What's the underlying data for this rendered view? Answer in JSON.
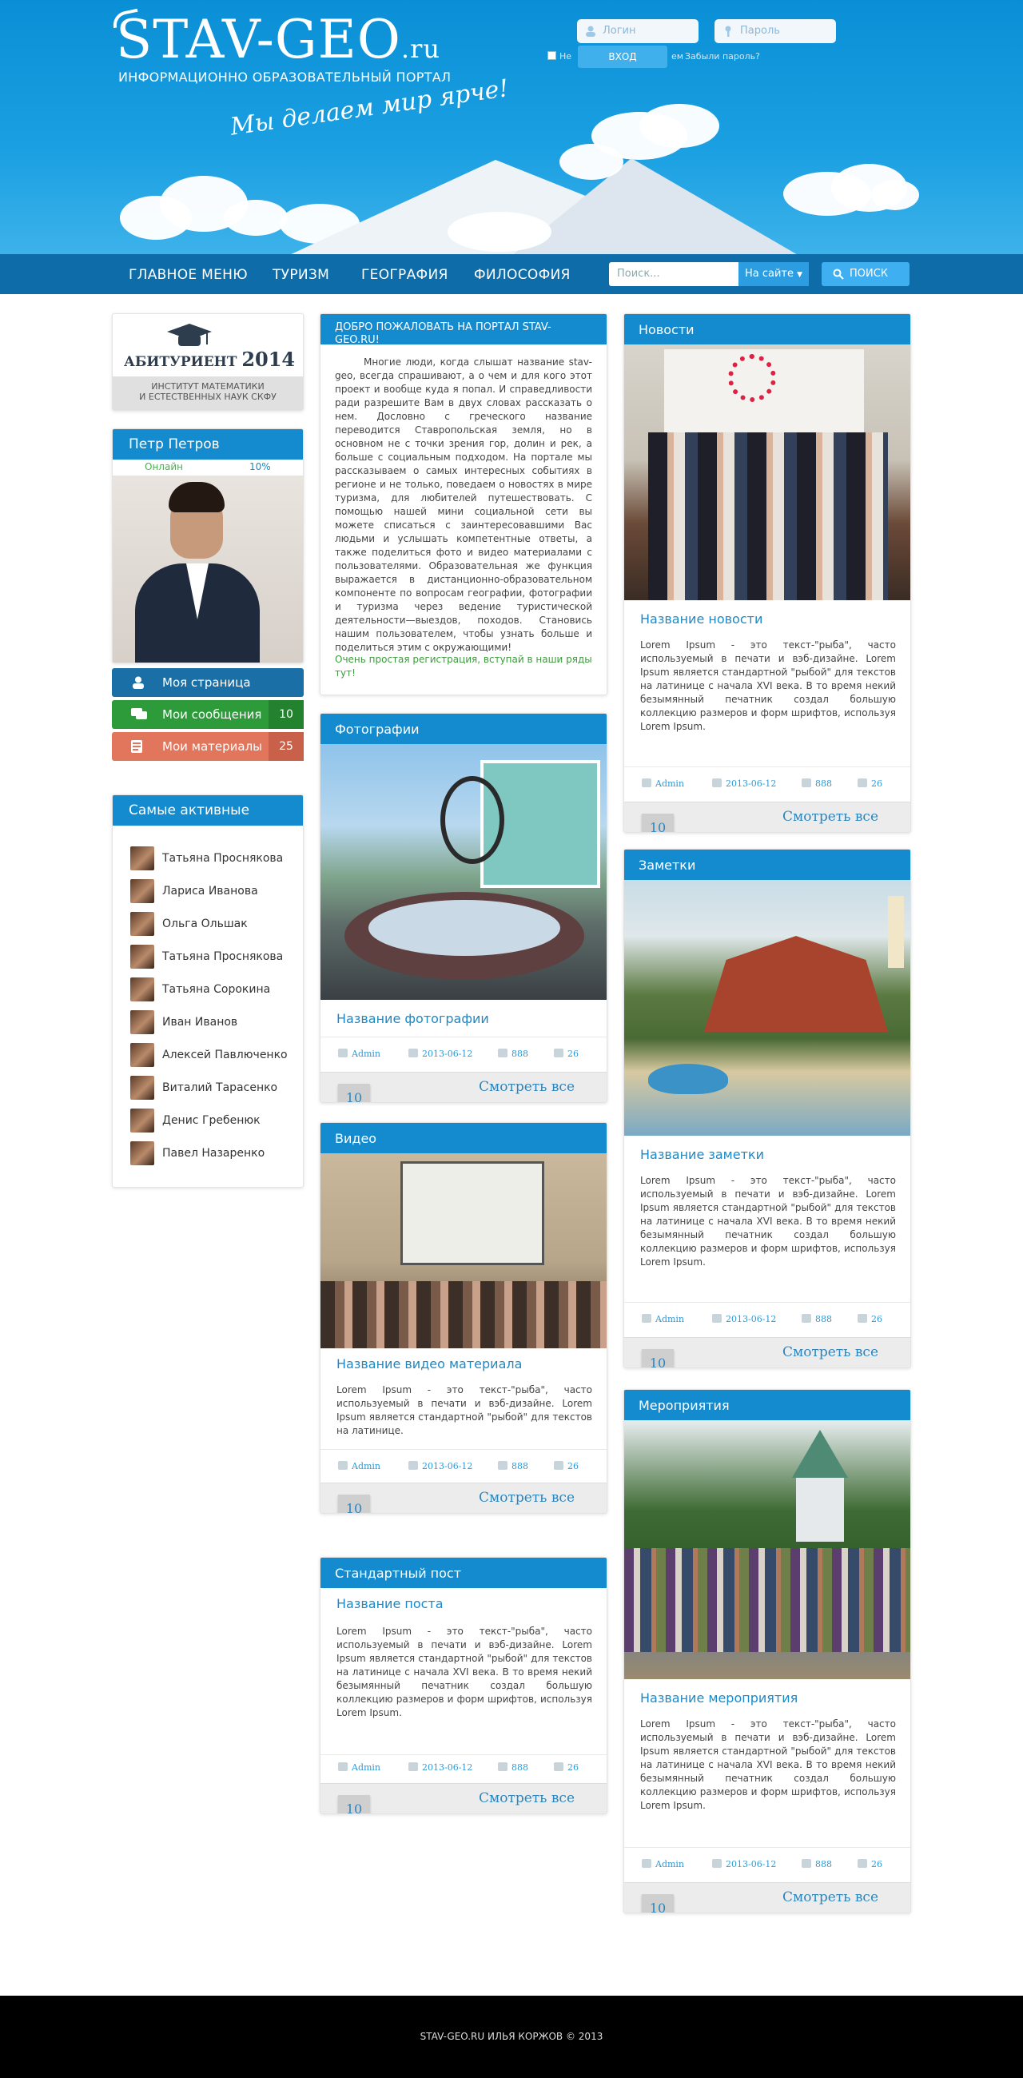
{
  "header": {
    "logo_main": "STAV-GEO",
    "logo_suffix": ".ru",
    "subtitle": "ИНФОРМАЦИОННО ОБРАЗОВАТЕЛЬНЫЙ ПОРТАЛ",
    "slogan": "Мы делаем мир ярче!",
    "login_placeholder": "Логин",
    "password_placeholder": "Пароль",
    "remember_label": "Не",
    "login_button": "ВХОД",
    "remember_tail": "ем",
    "forgot_link": "Забыли пароль?"
  },
  "nav": {
    "items": [
      "ГЛАВНОЕ МЕНЮ",
      "ТУРИЗМ",
      "ГЕОГРАФИЯ",
      "ФИЛОСОФИЯ"
    ],
    "search_placeholder": "Поиск...",
    "search_scope": "На сайте",
    "search_button": "ПОИСК"
  },
  "sidebar": {
    "banner_title": "АБИТУРИЕНТ",
    "banner_year": "2014",
    "banner_sub1": "ИНСТИТУТ МАТЕМАТИКИ",
    "banner_sub2": "И ЕСТЕСТВЕННЫХ НАУК СКФУ",
    "profile_name": "Петр Петров",
    "profile_status": "Онлайн",
    "profile_percent": "10%",
    "buttons": [
      {
        "label": "Моя страница",
        "count": "",
        "color": "#1a6fa7"
      },
      {
        "label": "Мои сообщения",
        "count": "10",
        "color": "#2e9b3a"
      },
      {
        "label": "Мои материалы",
        "count": "25",
        "color": "#e2765c"
      }
    ],
    "active_title": "Самые активные",
    "active_users": [
      "Татьяна Проснякова",
      "Лариса Иванова",
      "Ольга Ольшак",
      "Татьяна Проснякова",
      "Татьяна Сорокина",
      "Иван Иванов",
      "Алексей Павлюченко",
      "Виталий Тарасенко",
      "Денис Гребенюк",
      "Павел Назаренко"
    ]
  },
  "welcome": {
    "title": "ДОБРО ПОЖАЛОВАТЬ НА ПОРТАЛ STAV-GEO.RU!",
    "text": "Многие люди, когда слышат название stav-geo, всегда спрашивают, а о чем и для кого этот проект и вообще куда я попал. И справедливости ради разрешите Вам в двух словах рассказать о нем. Дословно с греческого название переводится Ставропольская земля, но в основном не с точки зрения гор, долин и рек, а больше с социальным подходом. На портале мы рассказываем о самых интересных событиях в регионе и не только, поведаем о новостях в мире туризма, для любителей путешествовать. С помощью нашей мини социальной сети вы можете списаться с заинтересовавшими Вас людьми и услышать компетентные ответы, а также поделиться фото и видео материалами с пользователями. Образовательная же функция выражается в дистанционно-образовательном компоненте по вопросам географии, фотографии и туризма через ведение туристической деятельности—выездов, походов. Становись нашим пользователем, чтобы узнать больше и поделиться этим с окружающими!",
    "cta": "Очень простая регистрация, вступай в наши ряды тут!"
  },
  "lorem_full": "Lorem Ipsum - это текст-\"рыба\", часто используемый в печати и вэб-дизайне. Lorem Ipsum является стандартной \"рыбой\" для текстов на латинице с начала XVI века. В то время некий безымянный печатник создал большую коллекцию размеров и форм шрифтов, используя Lorem Ipsum.",
  "lorem_short": "Lorem Ipsum - это текст-\"рыба\", часто используемый в печати и вэб-дизайне. Lorem Ipsum является стандартной \"рыбой\" для текстов на латинице.",
  "meta": {
    "author": "Admin",
    "date": "2013-06-12",
    "views": "888",
    "comments": "26"
  },
  "footer_count": "10",
  "view_all": "Смотреть все",
  "photos_card": {
    "head": "Фотографии",
    "title": "Название фотографии"
  },
  "video_card": {
    "head": "Видео",
    "title": "Название видео материала"
  },
  "post_card": {
    "head": "Стандартный пост",
    "title": "Название поста"
  },
  "news_card": {
    "head": "Новости",
    "title": "Название новости"
  },
  "notes_card": {
    "head": "Заметки",
    "title": "Название заметки"
  },
  "events_card": {
    "head": "Мероприятия",
    "title": "Название мероприятия"
  },
  "footer": {
    "text": "STAV-GEO.RU ИЛЬЯ КОРЖОВ © 2013"
  }
}
